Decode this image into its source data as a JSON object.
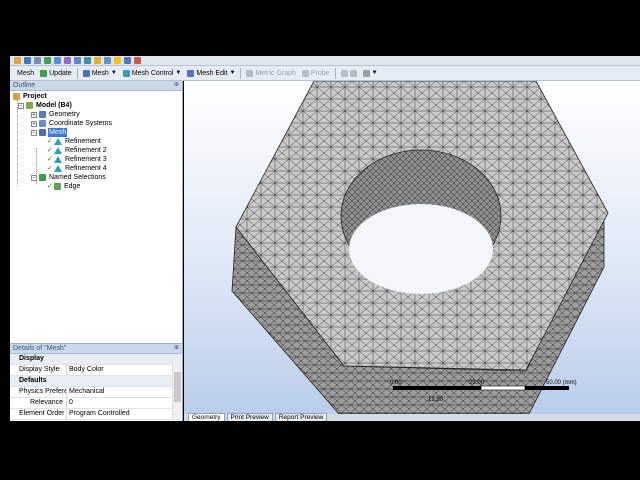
{
  "toolbar_top": {
    "icons": [
      "open-icon",
      "save-icon",
      "undo-icon",
      "select-icon",
      "rotate-icon",
      "pan-icon",
      "zoom-icon",
      "fit-icon",
      "box-zoom-icon",
      "mesh-icon",
      "cursor-icon",
      "view-icon",
      "axis-icon"
    ]
  },
  "toolbar_mesh": {
    "mesh_label": "Mesh",
    "update_label": "Update",
    "mesh_menu_label": "Mesh",
    "mesh_control_label": "Mesh Control",
    "mesh_edit_label": "Mesh Edit",
    "metric_graph_label": "Metric Graph",
    "probe_label": "Probe"
  },
  "outline": {
    "title": "Outline",
    "tree": {
      "project": "Project",
      "model": "Model (B4)",
      "geometry": "Geometry",
      "coordinate_systems": "Coordinate Systems",
      "mesh": "Mesh",
      "refinements": [
        "Refinement",
        "Refinement 2",
        "Refinement 3",
        "Refinement 4"
      ],
      "named_selections": "Named Selections",
      "edge": "Edge"
    }
  },
  "details": {
    "title": "Details of \"Mesh\"",
    "sections": [
      {
        "name": "Display",
        "rows": [
          {
            "key": "Display Style",
            "value": "Body Color"
          }
        ]
      },
      {
        "name": "Defaults",
        "rows": [
          {
            "key": "Physics Preference",
            "value": "Mechanical"
          },
          {
            "key": "Relevance",
            "value": "0"
          },
          {
            "key": "Element Order",
            "value": "Program Controlled"
          }
        ]
      }
    ]
  },
  "viewport": {
    "scale": {
      "labels": [
        "0.00",
        "25.00",
        "50.00 (mm)"
      ],
      "mid": "12.50"
    },
    "tabs": [
      "Geometry",
      "Print Preview",
      "Report Preview"
    ],
    "active_tab": "Geometry"
  }
}
